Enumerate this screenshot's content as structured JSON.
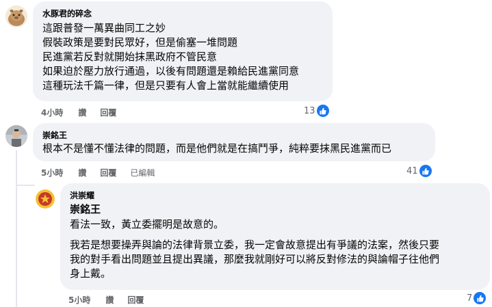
{
  "comments": [
    {
      "author": "水豚君的碎念",
      "avatar_icon": "capybara-avatar-icon",
      "lines": [
        "這跟普發一萬異曲同工之妙",
        "假裝政策是要對民眾好，但是偷塞一堆問題",
        "民進黨若反對就開始抹黑政府不管民意",
        "如果迫於壓力放行通過，以後有問題還是賴給民進黨同意",
        "這種玩法千篇一律，但是只要有人會上當就能繼續使用"
      ],
      "time": "4小時",
      "like_label": "讚",
      "reply_label": "回覆",
      "reaction_count": "13"
    },
    {
      "author": "崇銘王",
      "avatar_icon": "user-photo-avatar-icon",
      "lines": [
        "根本不是懂不懂法律的問題，而是他們就是在搞鬥爭，純粹要抹黑民進黨而已"
      ],
      "time": "5小時",
      "like_label": "讚",
      "reply_label": "回覆",
      "edited_label": "已編輯",
      "reaction_count": "41"
    }
  ],
  "reply": {
    "author": "洪崇耀",
    "avatar_icon": "emblem-avatar-icon",
    "mention": "崇銘王",
    "lines_first": [
      "看法一致，黃立委擺明是故意的。"
    ],
    "lines_second": [
      "我若是想要操弄與論的法律背景立委，我一定會故意提出有爭議的法案，然後只要",
      "我的對手看出問題並且提出異議，那麼我就剛好可以將反對修法的與論帽子往他們",
      "身上戴。"
    ],
    "time": "5小時",
    "like_label": "讚",
    "reply_label": "回覆",
    "reaction_count": "7"
  },
  "colors": {
    "bubble": "#f0f2f5",
    "like_blue": "#1877f2",
    "meta_gray": "#65676b"
  }
}
